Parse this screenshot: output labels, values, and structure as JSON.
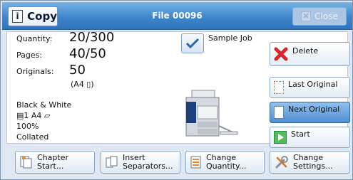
{
  "titlebar": {
    "title": "Copy",
    "file_name": "File 00096",
    "close_label": "Close"
  },
  "info": {
    "quantity_label": "Quantity:",
    "quantity_value": "20/300",
    "pages_label": "Pages:",
    "pages_value": "40/50",
    "originals_label": "Originals:",
    "originals_value": "50",
    "original_size": "(A4 ▯)",
    "color_mode": "Black & White",
    "paper_tray": "▤1  A4 ▱",
    "reduce_enlarge": "100%",
    "output": "Collated"
  },
  "sample_job": {
    "label": "Sample Job",
    "checked": true
  },
  "side_buttons": {
    "delete": "Delete",
    "last_original": "Last Original",
    "next_original": "Next Original",
    "start": "Start"
  },
  "bottom_buttons": {
    "chapter_start": "Chapter Start...",
    "insert_separators_l1": "Insert",
    "insert_separators_l2": "Separators...",
    "change_quantity_l1": "Change",
    "change_quantity_l2": "Quantity...",
    "change_settings_l1": "Change",
    "change_settings_l2": "Settings..."
  },
  "colors": {
    "title_bar": "#3f86cc",
    "active_button": "#4f8fd2",
    "delete_icon": "#d8262c",
    "start_icon": "#3aa64a"
  }
}
